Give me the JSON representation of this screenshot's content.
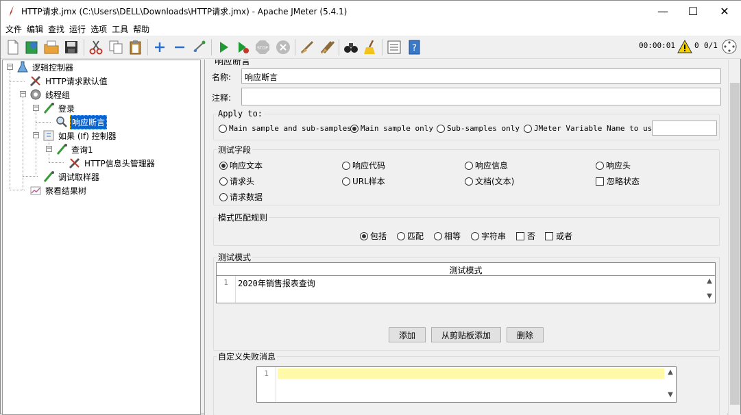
{
  "window": {
    "title": "HTTP请求.jmx (C:\\Users\\DELL\\Downloads\\HTTP请求.jmx) - Apache JMeter (5.4.1)",
    "minimize": "—",
    "maximize": "☐",
    "close": "✕"
  },
  "menu": [
    "文件",
    "编辑",
    "查找",
    "运行",
    "选项",
    "工具",
    "帮助"
  ],
  "toolbar": {
    "timer": "00:00:01",
    "warn_count": "0",
    "threads": "0/1"
  },
  "tree": {
    "nodes": [
      {
        "label": "逻辑控制器",
        "icon": "flask-icon"
      },
      {
        "label": "HTTP请求默认值",
        "icon": "wrench-icon"
      },
      {
        "label": "线程组",
        "icon": "gear-icon"
      },
      {
        "label": "登录",
        "icon": "pipette-icon"
      },
      {
        "label": "响应断言",
        "icon": "magnifier-icon"
      },
      {
        "label": "如果 (If) 控制器",
        "icon": "controller-icon"
      },
      {
        "label": "查询1",
        "icon": "pipette-icon"
      },
      {
        "label": "HTTP信息头管理器",
        "icon": "wrench-icon"
      },
      {
        "label": "调试取样器",
        "icon": "pipette-icon"
      },
      {
        "label": "察看结果树",
        "icon": "chart-icon"
      }
    ]
  },
  "panel": {
    "heading_partial": "响应断言",
    "name_label": "名称:",
    "name_value": "响应断言",
    "comment_label": "注释:",
    "comment_value": "",
    "apply_to": {
      "legend": "Apply to:",
      "options": [
        "Main sample and sub-samples",
        "Main sample only",
        "Sub-samples only",
        "JMeter Variable Name to use"
      ],
      "selected": 1,
      "var_value": ""
    },
    "test_field": {
      "legend": "测试字段",
      "options": [
        "响应文本",
        "响应代码",
        "响应信息",
        "响应头",
        "请求头",
        "URL样本",
        "文档(文本)",
        "忽略状态",
        "请求数据"
      ],
      "selected": 0
    },
    "pattern_rules": {
      "legend": "模式匹配规则",
      "options": [
        "包括",
        "匹配",
        "相等",
        "字符串",
        "否",
        "或者"
      ],
      "selected": 0
    },
    "test_patterns": {
      "legend": "测试模式",
      "column_header": "测试模式",
      "row_number": "1",
      "row_value": "2020年销售报表查询",
      "add_button": "添加",
      "paste_button": "从剪贴板添加",
      "delete_button": "删除"
    },
    "custom_failure": {
      "legend": "自定义失败消息",
      "line_number": "1",
      "value": ""
    }
  }
}
